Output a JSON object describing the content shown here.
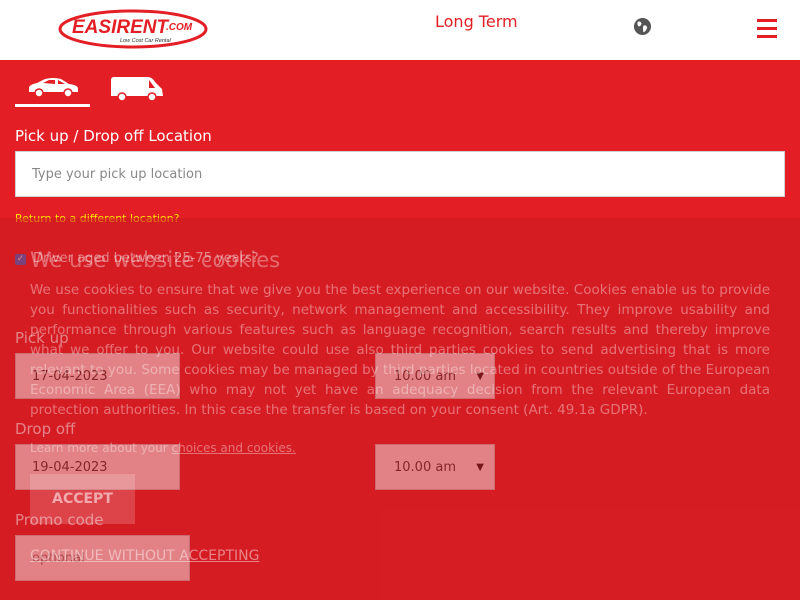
{
  "header": {
    "logo_text": "EASIRENT.COM",
    "logo_tagline": "Low Cost Car Rental",
    "nav_long_term": "Long Term",
    "globe_icon": "globe-icon",
    "menu_icon": "hamburger-menu-icon"
  },
  "form": {
    "vehicle_tabs": [
      {
        "name": "car",
        "icon": "car-icon",
        "active": true
      },
      {
        "name": "van",
        "icon": "van-icon",
        "active": false
      }
    ],
    "location_label": "Pick up / Drop off Location",
    "location_placeholder": "Type your pick up location",
    "return_link": "Return to a different location?",
    "driver_age_label": "Driver aged between 25-75 years?",
    "driver_age_checked": true,
    "pickup_label": "Pick up",
    "pickup_date": "17-04-2023",
    "pickup_time": "10.00 am",
    "dropoff_label": "Drop off",
    "dropoff_date": "19-04-2023",
    "dropoff_time": "10.00 am",
    "promo_label": "Promo code",
    "promo_placeholder": "optional"
  },
  "cookie_banner": {
    "title": "We use website cookies",
    "body": "We use cookies to ensure that we give you the best experience on our website. Cookies enable us to provide you functionalities such as security, network management and accessibility. They improve usability and performance through various features such as language recognition, search results and thereby improve what we offer to you. Our website could use also third parties cookies to send advertising that is more relevant to you. Some cookies may be managed by third parties located in countries outside of the European Economic Area (EEA) who may not yet have an adequacy decision from the relevant European data protection authorities. In this case the transfer is based on your consent (Art. 49.1a GDPR).",
    "learn_more_prefix": "Learn more about your ",
    "learn_more_link": "choices and cookies.",
    "accept_button": "ACCEPT",
    "continue_link": "CONTINUE WITHOUT ACCEPTING"
  },
  "colors": {
    "brand_red": "#e31e24",
    "link_yellow": "#ffe600",
    "checkbox_blue": "#1a73e8"
  }
}
